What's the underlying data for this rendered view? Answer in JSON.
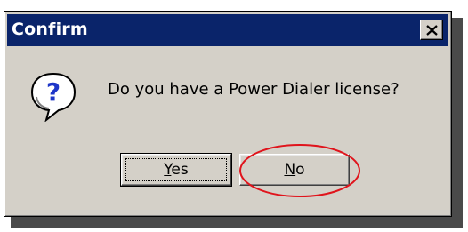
{
  "window": {
    "title": "Confirm"
  },
  "dialog": {
    "message": "Do you have a Power Dialer license?",
    "icon": "question-icon"
  },
  "buttons": {
    "yes": {
      "mnemonic": "Y",
      "rest": "es"
    },
    "no": {
      "mnemonic": "N",
      "rest": "o"
    }
  },
  "colors": {
    "titlebar": "#0a246a",
    "window_face": "#d4d0c8",
    "annotation": "#e0141c",
    "icon_blue": "#1e36c8"
  }
}
